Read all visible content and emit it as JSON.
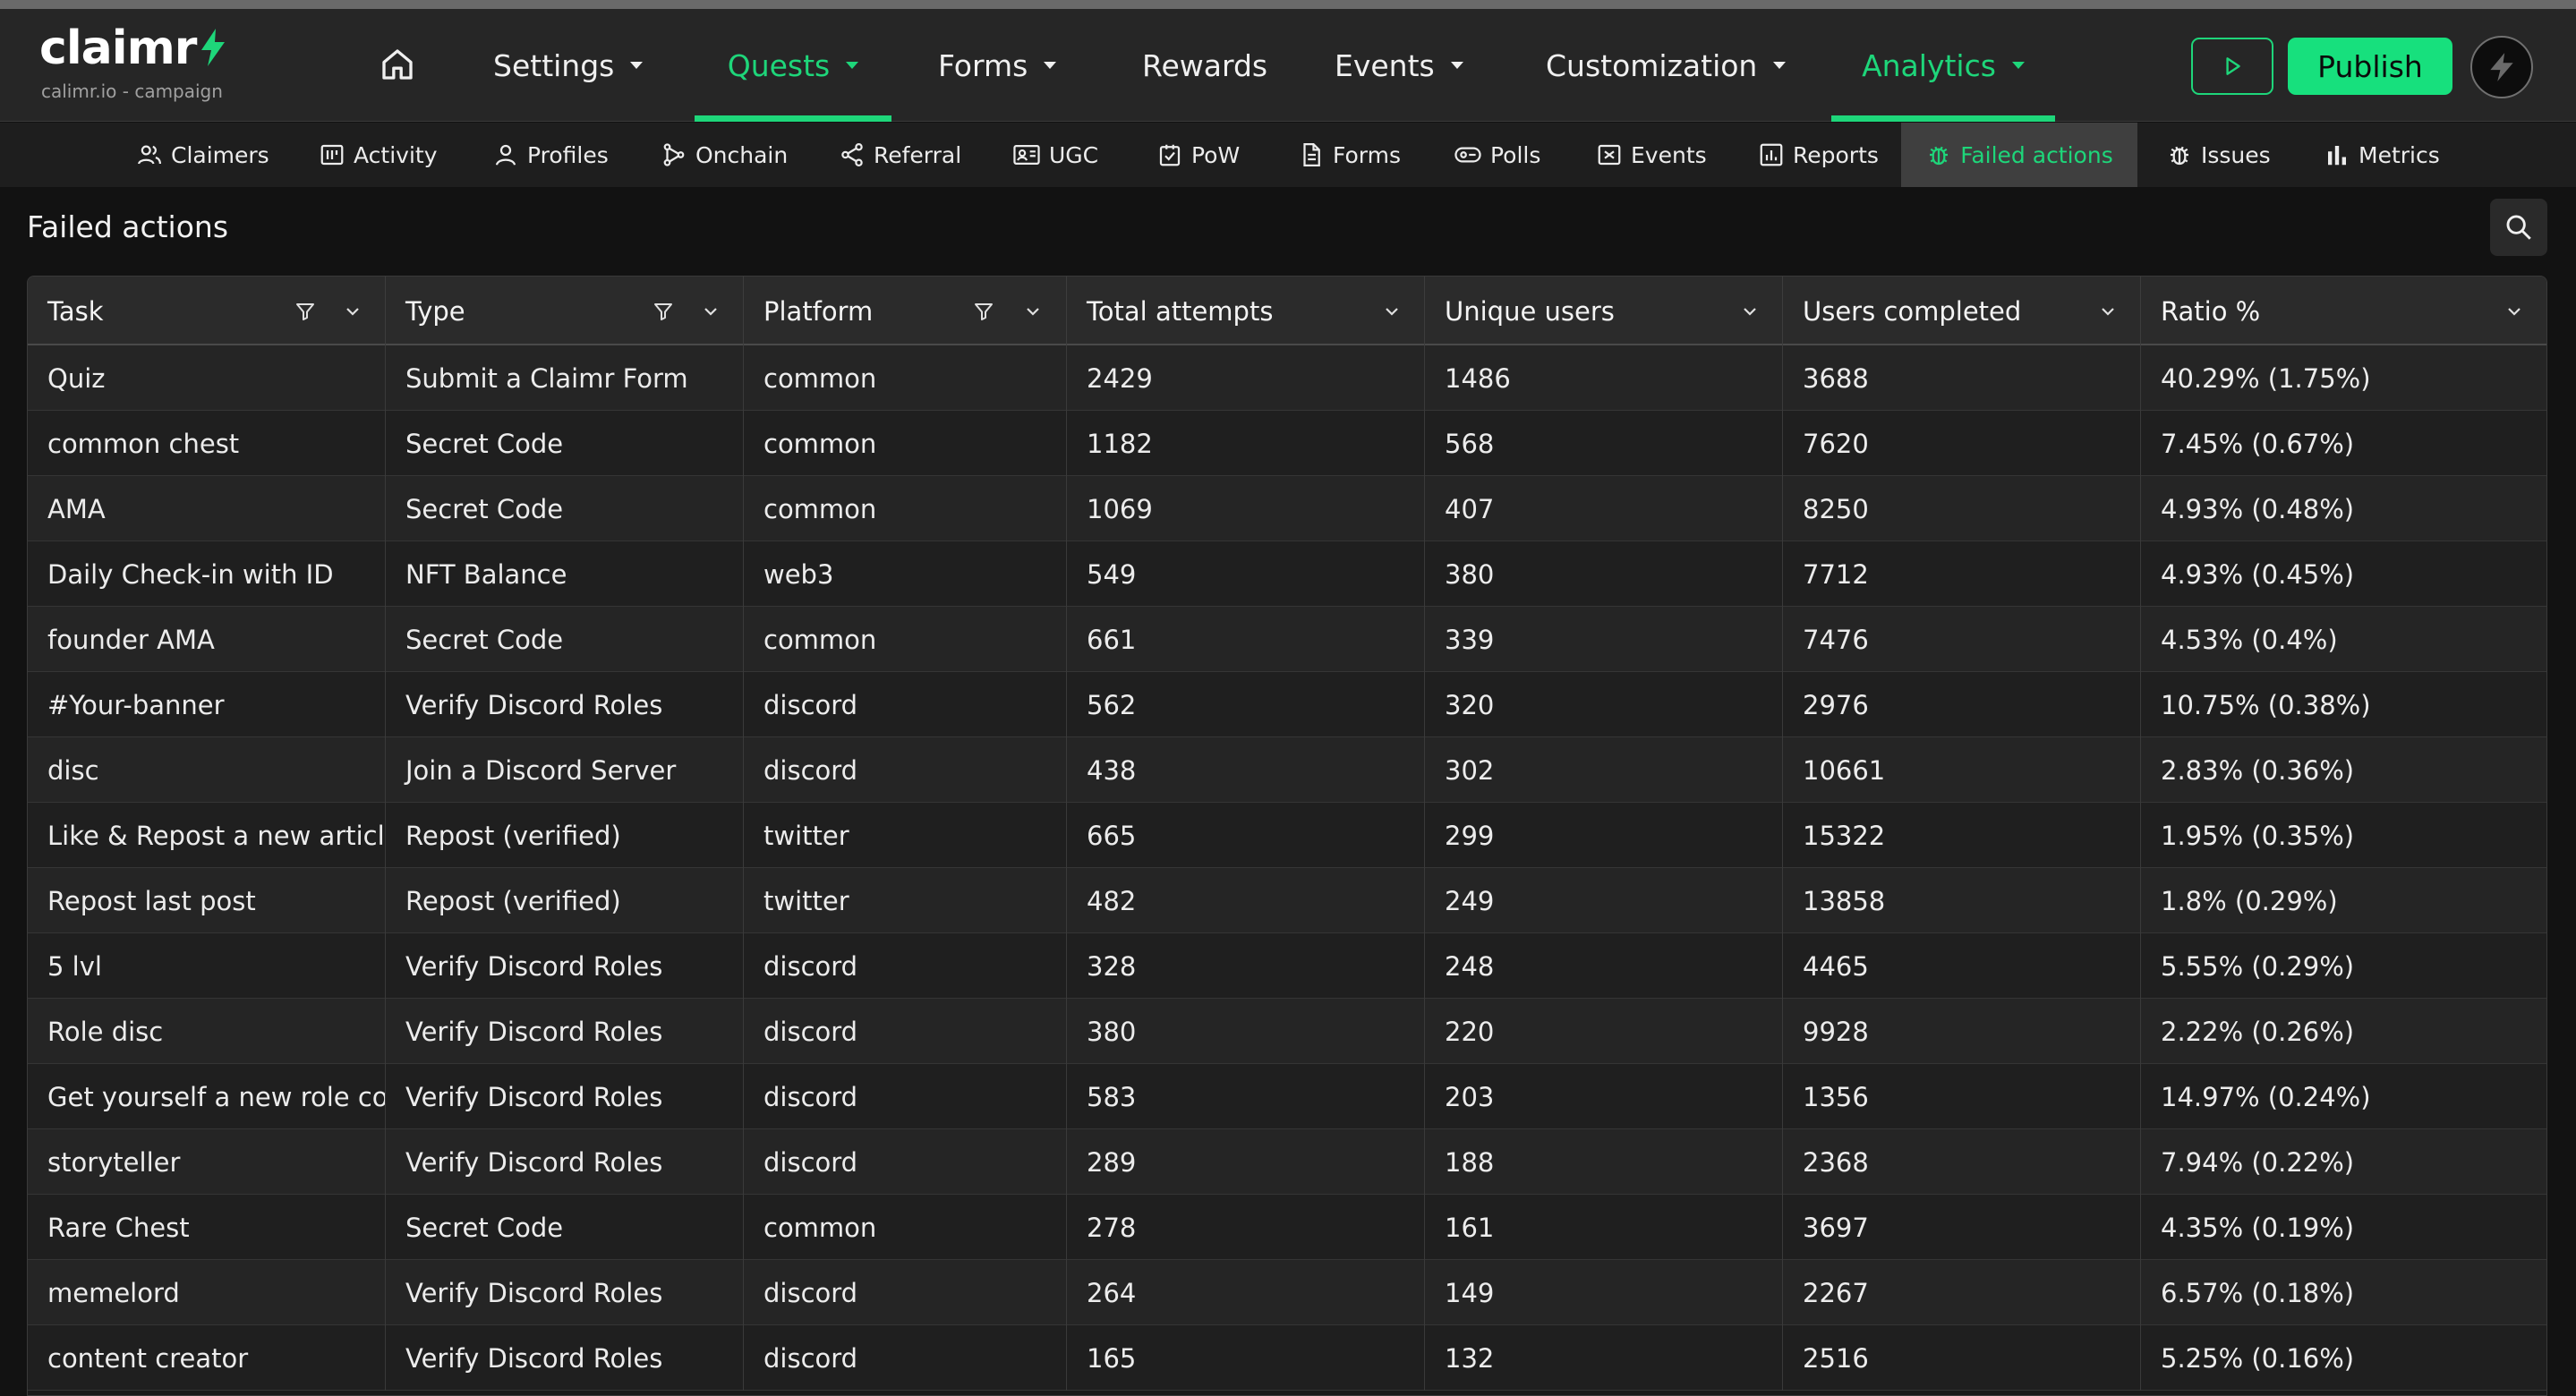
{
  "brand": {
    "name": "claimr",
    "subtitle": "calimr.io - campaign"
  },
  "nav": {
    "home_icon": "home-icon",
    "items": [
      {
        "label": "Settings",
        "has_caret": true
      },
      {
        "label": "Quests",
        "has_caret": true,
        "active": true
      },
      {
        "label": "Forms",
        "has_caret": true
      },
      {
        "label": "Rewards",
        "has_caret": false
      },
      {
        "label": "Events",
        "has_caret": true
      },
      {
        "label": "Customization",
        "has_caret": true
      },
      {
        "label": "Analytics",
        "has_caret": true,
        "active": true
      }
    ],
    "publish_label": "Publish",
    "preview_icon": "play-icon",
    "avatar_icon": "bolt-icon"
  },
  "subnav": [
    {
      "label": "Claimers",
      "icon": "users-icon"
    },
    {
      "label": "Activity",
      "icon": "activity-icon"
    },
    {
      "label": "Profiles",
      "icon": "user-icon"
    },
    {
      "label": "Onchain",
      "icon": "onchain-icon"
    },
    {
      "label": "Referral",
      "icon": "share-icon"
    },
    {
      "label": "UGC",
      "icon": "ugc-icon"
    },
    {
      "label": "PoW",
      "icon": "pow-icon"
    },
    {
      "label": "Forms",
      "icon": "form-icon"
    },
    {
      "label": "Polls",
      "icon": "polls-icon"
    },
    {
      "label": "Events",
      "icon": "ticket-icon"
    },
    {
      "label": "Reports",
      "icon": "reports-icon"
    },
    {
      "label": "Failed actions",
      "icon": "bug-icon",
      "active": true
    },
    {
      "label": "Issues",
      "icon": "bug-icon"
    },
    {
      "label": "Metrics",
      "icon": "bar-chart-icon"
    }
  ],
  "page": {
    "title": "Failed actions",
    "search_icon": "search-icon"
  },
  "colors": {
    "accent": "#1ed67a",
    "background": "#121212",
    "panel": "#262626"
  },
  "table": {
    "columns": [
      {
        "label": "Task",
        "filter": true
      },
      {
        "label": "Type",
        "filter": true
      },
      {
        "label": "Platform",
        "filter": true
      },
      {
        "label": "Total attempts",
        "filter": false
      },
      {
        "label": "Unique users",
        "filter": false
      },
      {
        "label": "Users completed",
        "filter": false
      },
      {
        "label": "Ratio %",
        "filter": false
      }
    ],
    "rows": [
      [
        "Quiz",
        "Submit a Claimr Form",
        "common",
        "2429",
        "1486",
        "3688",
        "40.29% (1.75%)"
      ],
      [
        "common chest",
        "Secret Code",
        "common",
        "1182",
        "568",
        "7620",
        "7.45% (0.67%)"
      ],
      [
        "AMA",
        "Secret Code",
        "common",
        "1069",
        "407",
        "8250",
        "4.93% (0.48%)"
      ],
      [
        "Daily Check-in with ID",
        "NFT Balance",
        "web3",
        "549",
        "380",
        "7712",
        "4.93% (0.45%)"
      ],
      [
        "founder AMA",
        "Secret Code",
        "common",
        "661",
        "339",
        "7476",
        "4.53% (0.4%)"
      ],
      [
        "#Your-banner",
        "Verify Discord Roles",
        "discord",
        "562",
        "320",
        "2976",
        "10.75% (0.38%)"
      ],
      [
        "disc",
        "Join a Discord Server",
        "discord",
        "438",
        "302",
        "10661",
        "2.83% (0.36%)"
      ],
      [
        "Like & Repost a new articl...",
        "Repost (verified)",
        "twitter",
        "665",
        "299",
        "15322",
        "1.95% (0.35%)"
      ],
      [
        "Repost last post",
        "Repost (verified)",
        "twitter",
        "482",
        "249",
        "13858",
        "1.8% (0.29%)"
      ],
      [
        "5 lvl",
        "Verify Discord Roles",
        "discord",
        "328",
        "248",
        "4465",
        "5.55% (0.29%)"
      ],
      [
        "Role disc",
        "Verify Discord Roles",
        "discord",
        "380",
        "220",
        "9928",
        "2.22% (0.26%)"
      ],
      [
        "Get yourself a new role co...",
        "Verify Discord Roles",
        "discord",
        "583",
        "203",
        "1356",
        "14.97% (0.24%)"
      ],
      [
        "storyteller",
        "Verify Discord Roles",
        "discord",
        "289",
        "188",
        "2368",
        "7.94% (0.22%)"
      ],
      [
        "Rare Chest",
        "Secret Code",
        "common",
        "278",
        "161",
        "3697",
        "4.35% (0.19%)"
      ],
      [
        "memelord",
        "Verify Discord Roles",
        "discord",
        "264",
        "149",
        "2267",
        "6.57% (0.18%)"
      ],
      [
        "content creator",
        "Verify Discord Roles",
        "discord",
        "165",
        "132",
        "2516",
        "5.25% (0.16%)"
      ]
    ]
  }
}
